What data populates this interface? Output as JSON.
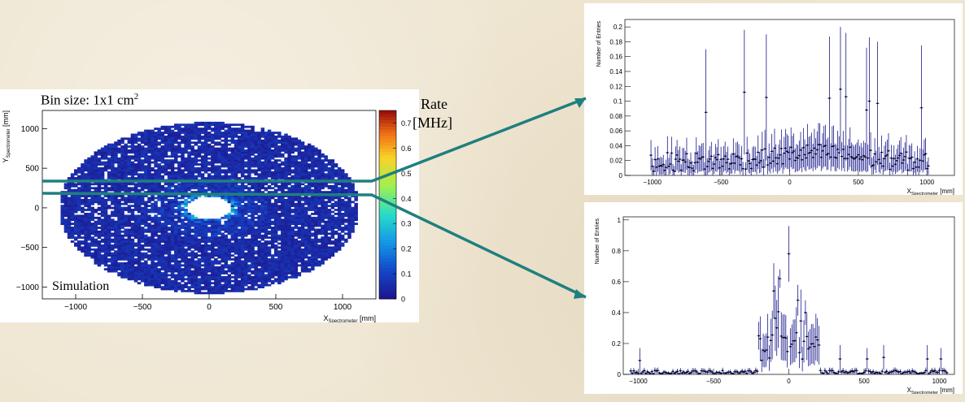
{
  "slide": {
    "bin_size_label": "Bin size: 1x1 cm",
    "bin_size_exp": "2",
    "simulation_label": "Simulation",
    "rate_label_line1": "Rate",
    "rate_label_line2": "[MHz]"
  },
  "colors": {
    "background": "#efe6d2",
    "arrow": "#1f7f7f",
    "hist_line": "#1a1a8c",
    "hist_marker": "#000000"
  },
  "chart_data": [
    {
      "type": "heatmap",
      "title": "",
      "xlabel": "X",
      "xlabel_sub": "Spectrometer",
      "xlabel_unit": "[mm]",
      "ylabel": "Y",
      "ylabel_sub": "Spectrometer",
      "ylabel_unit": "[mm]",
      "xlim": [
        -1250,
        1250
      ],
      "ylim": [
        -1150,
        1230
      ],
      "xticks": [
        -1000,
        -500,
        0,
        500,
        1000
      ],
      "yticks": [
        -1000,
        -500,
        0,
        500,
        1000
      ],
      "shape": "annulus",
      "outer_radius_x": 1120,
      "outer_radius_y": 1080,
      "inner_radius_x": 170,
      "inner_radius_y": 140,
      "typical_rate": 0.05,
      "peak_rate_near_hole": 0.35,
      "colorbar_range": [
        0,
        0.75
      ],
      "colorbar_ticks": [
        0,
        0.1,
        0.2,
        0.3,
        0.4,
        0.5,
        0.6,
        0.7
      ],
      "slice_bands_y_mm": [
        330,
        160
      ]
    },
    {
      "type": "scatter",
      "title": "",
      "xlabel": "X",
      "xlabel_sub": "Spectrometer",
      "xlabel_unit": "[mm]",
      "ylabel": "Number of Entries",
      "xlim": [
        -1200,
        1200
      ],
      "ylim": [
        0,
        0.21
      ],
      "xticks": [
        -1000,
        -500,
        0,
        500,
        1000
      ],
      "yticks": [
        0,
        0.02,
        0.04,
        0.06,
        0.08,
        0.1,
        0.12,
        0.14,
        0.16,
        0.18,
        0.2
      ],
      "ytick_labels": [
        "0",
        "0.02",
        "0.04",
        "0.06",
        "0.08",
        "0.1",
        "0.12",
        "0.14",
        "0.16",
        "0.18",
        "0.2"
      ],
      "data_xrange": [
        -1010,
        1010
      ],
      "baseline_mean": 0.018,
      "peaks": [
        {
          "x": -610,
          "y": 0.085,
          "err_hi": 0.17
        },
        {
          "x": -330,
          "y": 0.112,
          "err_hi": 0.196
        },
        {
          "x": -170,
          "y": 0.105,
          "err_hi": 0.19
        },
        {
          "x": 290,
          "y": 0.104,
          "err_hi": 0.187
        },
        {
          "x": 370,
          "y": 0.116,
          "err_hi": 0.2
        },
        {
          "x": 410,
          "y": 0.106,
          "err_hi": 0.192
        },
        {
          "x": 560,
          "y": 0.088,
          "err_hi": 0.172
        },
        {
          "x": 580,
          "y": 0.1,
          "err_hi": 0.186
        },
        {
          "x": 640,
          "y": 0.097,
          "err_hi": 0.18
        },
        {
          "x": 960,
          "y": 0.091,
          "err_hi": 0.175
        }
      ]
    },
    {
      "type": "scatter",
      "title": "",
      "xlabel": "X",
      "xlabel_sub": "Spectrometer",
      "xlabel_unit": "[mm]",
      "ylabel": "Number of Entries",
      "xlim": [
        -1100,
        1100
      ],
      "ylim": [
        0,
        1.02
      ],
      "xticks": [
        -1000,
        -500,
        0,
        500,
        1000
      ],
      "yticks": [
        0,
        0.2,
        0.4,
        0.6,
        0.8,
        1
      ],
      "ytick_labels": [
        "0",
        "0.2",
        "0.4",
        "0.6",
        "0.8",
        "1"
      ],
      "data_xrange": [
        -1050,
        1050
      ],
      "baseline_mean": 0.015,
      "central_region": [
        -200,
        200
      ],
      "peaks": [
        {
          "x": -990,
          "y": 0.09,
          "err_hi": 0.17
        },
        {
          "x": -200,
          "y": 0.25,
          "err_hi": 0.34
        },
        {
          "x": -100,
          "y": 0.54,
          "err_hi": 0.72
        },
        {
          "x": -60,
          "y": 0.62,
          "err_hi": 0.68
        },
        {
          "x": 0,
          "y": 0.78,
          "err_hi": 0.96
        },
        {
          "x": 60,
          "y": 0.48,
          "err_hi": 0.58
        },
        {
          "x": 110,
          "y": 0.4,
          "err_hi": 0.48
        },
        {
          "x": 340,
          "y": 0.1,
          "err_hi": 0.19
        },
        {
          "x": 520,
          "y": 0.1,
          "err_hi": 0.17
        },
        {
          "x": 630,
          "y": 0.11,
          "err_hi": 0.19
        },
        {
          "x": 920,
          "y": 0.1,
          "err_hi": 0.19
        },
        {
          "x": 1010,
          "y": 0.1,
          "err_hi": 0.17
        }
      ]
    }
  ]
}
